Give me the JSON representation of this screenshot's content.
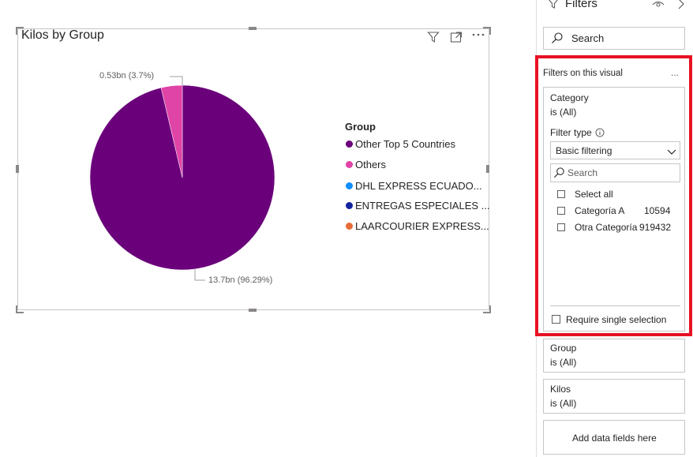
{
  "visual": {
    "title": "Kilos by Group",
    "header_icons": [
      "filter-icon",
      "focus-mode-icon",
      "more-options-icon"
    ]
  },
  "chart_data": {
    "type": "pie",
    "title": "Kilos by Group",
    "legend_title": "Group",
    "legend_position": "right",
    "slices": [
      {
        "name": "Other Top 5 Countries",
        "value_label": "13.7bn (96.29%)",
        "percent": 96.29,
        "color": "#6b007b"
      },
      {
        "name": "Others",
        "value_label": "0.53bn (3.7%)",
        "percent": 3.7,
        "color": "#e044a7"
      },
      {
        "name": "DHL EXPRESS ECUADO...",
        "percent": 0,
        "color": "#118dff"
      },
      {
        "name": "ENTREGAS ESPECIALES ...",
        "percent": 0,
        "color": "#12239e"
      },
      {
        "name": "LAARCOURIER EXPRESS...",
        "percent": 0,
        "color": "#e66c37"
      }
    ]
  },
  "filters_pane": {
    "title": "Filters",
    "search_placeholder": "Search",
    "section_title": "Filters on this visual",
    "more": "...",
    "category_card": {
      "field": "Category",
      "state": "is (All)",
      "filter_type_label": "Filter type",
      "filter_type_value": "Basic filtering",
      "search_placeholder": "Search",
      "items": [
        {
          "label": "Select all",
          "count": ""
        },
        {
          "label": "Categoría A",
          "count": "10594"
        },
        {
          "label": "Otra Categoría",
          "count": "919432"
        }
      ],
      "require_single": "Require single selection"
    },
    "group_card": {
      "field": "Group",
      "state": "is (All)"
    },
    "kilos_card": {
      "field": "Kilos",
      "state": "is (All)"
    },
    "add_fields": "Add data fields here"
  }
}
